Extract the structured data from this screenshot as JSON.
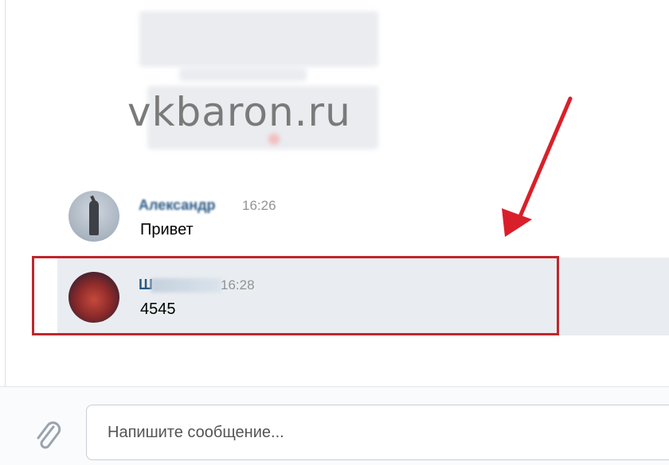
{
  "watermark": "vkbaron.ru",
  "messages": [
    {
      "sender": "Александр",
      "time": "16:26",
      "text": "Привет"
    },
    {
      "sender": "Ш",
      "time": "16:28",
      "text": "4545"
    }
  ],
  "composer": {
    "placeholder": "Напишите сообщение...",
    "attach_icon": "paperclip-icon"
  },
  "colors": {
    "highlight": "#c0262d",
    "sender_link": "#2a5885",
    "selected_row": "#e9edf1"
  }
}
